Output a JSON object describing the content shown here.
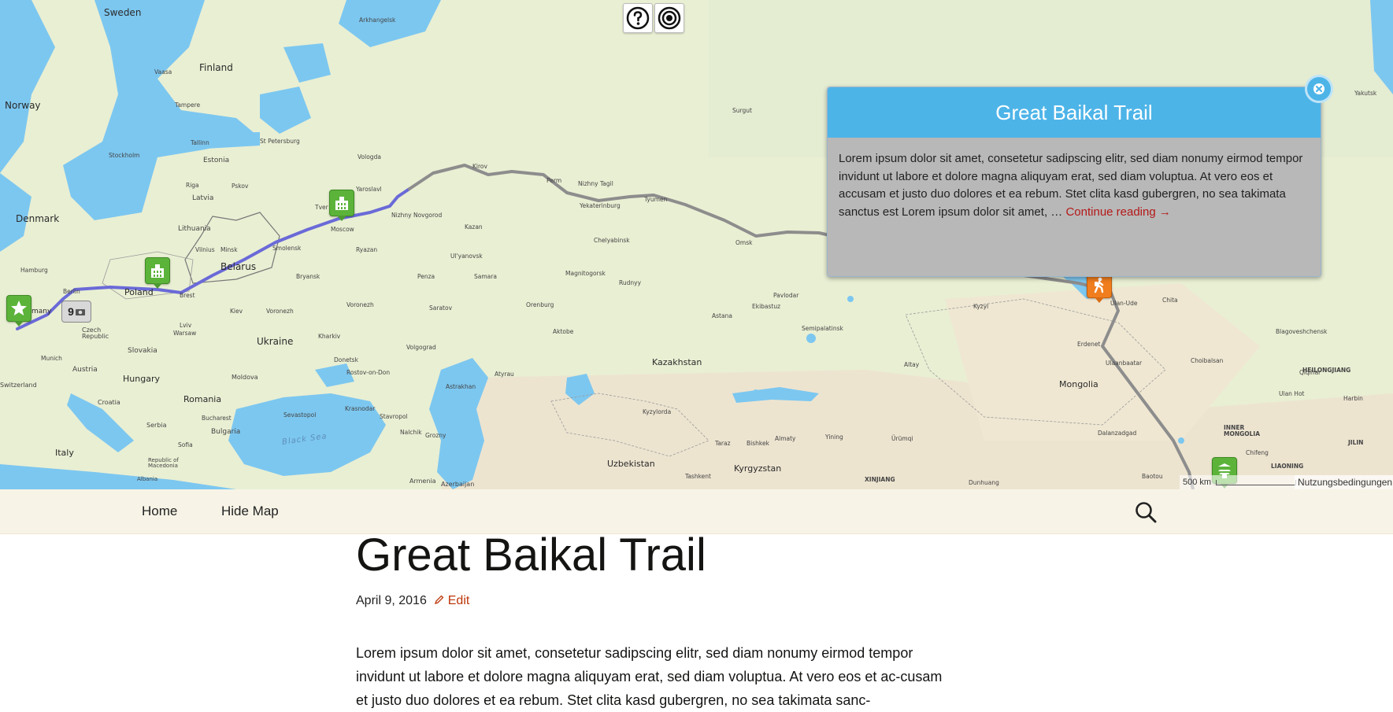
{
  "map": {
    "labels": {
      "sweden": "Sweden",
      "finland": "Finland",
      "norway": "Norway",
      "denmark": "Denmark",
      "estonia": "Estonia",
      "latvia": "Latvia",
      "lithuania": "Lithuania",
      "belarus": "Belarus",
      "poland": "Poland",
      "ukraine": "Ukraine",
      "czech": "Czech\nRepublic",
      "slovakia": "Slovakia",
      "austria": "Austria",
      "hungary": "Hungary",
      "romania": "Romania",
      "moldova": "Moldova",
      "serbia": "Serbia",
      "bulgaria": "Bulgaria",
      "croatia": "Croatia",
      "italy": "Italy",
      "kazakhstan": "Kazakhstan",
      "uzbekistan": "Uzbekistan",
      "kyrgyzstan": "Kyrgyzstan",
      "mongolia": "Mongolia",
      "armenia": "Armenia",
      "azerbaijan": "Azerbaijan",
      "albania": "Albania",
      "macedonia": "Republic of\nMacedonia",
      "switzerland": "Switzerland",
      "germany": "many",
      "black_sea": "Black Sea",
      "inner_mongolia": "INNER\nMONGOLIA",
      "liaoning": "LIAONING",
      "heilongjiang": "HEILONGJIANG",
      "jilin": "JILIN",
      "xinjiang": "XINJIANG",
      "moscow": "Moscow",
      "berlin": "Berlin",
      "minsk": "Minsk",
      "warsaw": "Warsaw",
      "kiev": "Kiev",
      "kharkiv": "Kharkiv",
      "donetsk": "Donetsk",
      "rostov": "Rostov-on-Don",
      "volgograd": "Volgograd",
      "saratov": "Saratov",
      "samara": "Samara",
      "kazan": "Kazan",
      "perm": "Perm",
      "yekaterinburg": "Yekaterinburg",
      "tyumen": "Tyumen",
      "omsk": "Omsk",
      "surgut": "Surgut",
      "nizhny_novgorod": "Nizhny Novgorod",
      "yaroslavl": "Yaroslavl",
      "vologda": "Vologda",
      "ryazan": "Ryazan",
      "penza": "Penza",
      "ulyanovsk": "Ul'yanovsk",
      "chelyabinsk": "Chelyabinsk",
      "magnitogorsk": "Magnitogorsk",
      "orenburg": "Orenburg",
      "aktobe": "Aktobe",
      "astana": "Astana",
      "pavlodar": "Pavlodar",
      "ekibastuz": "Ekibastuz",
      "semipalatinsk": "Semipalatinsk",
      "rudnyy": "Rudnyy",
      "kyzylorda": "Kyzylorda",
      "almaty": "Almaty",
      "bishkek": "Bishkek",
      "taraz": "Taraz",
      "tashkent": "Tashkent",
      "yining": "Yining",
      "urumqi": "Ürümqi",
      "dunhuang": "Dunhuang",
      "ulan_ude": "Ulan-Ude",
      "chita": "Chita",
      "erdenet": "Erdenet",
      "ulaanbaatar": "Ulaanbaatar",
      "dalanzadgad": "Dalanzadgad",
      "choibalsan": "Choibalsan",
      "qiqihar": "Qiqihar",
      "harbin": "Harbin",
      "ulan_hot": "Ulan Hot",
      "chifeng": "Chifeng",
      "baotou": "Baotou",
      "blagoveshchensk": "Blagoveshchensk",
      "yakutsk": "Yakutsk",
      "kyzyl": "Kyzyl",
      "altay": "Altay",
      "stockholm": "Stockholm",
      "tampere": "Tampere",
      "vaasa": "Vaasa",
      "st_petersburg": "St Petersburg",
      "pskov": "Pskov",
      "tver": "Tver",
      "arkhangelsk": "Arkhangelsk",
      "kirov": "Kirov",
      "nizhny_tagil": "Nizhny Tagil",
      "hamburg": "Hamburg",
      "munich": "Munich",
      "bucharest": "Bucharest",
      "sofia": "Sofia",
      "krasnodar": "Krasnodar",
      "stavropol": "Stavropol",
      "astrakhan": "Astrakhan",
      "atyrau": "Atyrau",
      "nalchik": "Nalchik",
      "grozny": "Grozny",
      "sevastopol": "Sevastopol",
      "voronezh": "Voronezh",
      "bryansk": "Bryansk",
      "smolensk": "Smolensk",
      "vilnius": "Vilnius",
      "riga": "Riga",
      "tallinn": "Tallinn",
      "lviv": "Lviv",
      "brest": "Brest"
    },
    "help_icon": "question-icon",
    "locate_icon": "target-icon",
    "camera_count": "9",
    "popup": {
      "title": "Great Baikal Trail",
      "text": "Lorem ipsum dolor sit amet, consetetur sadipscing elitr, sed diam nonumy eirmod tempor invidunt ut labore et dolore magna aliquyam erat, sed diam voluptua. At vero eos et accusam et justo duo dolores et ea rebum. Stet clita kasd gubergren, no sea takimata sanctus est Lorem ipsum dolor sit amet, …",
      "link": "Continue reading →"
    },
    "scale": "500 km",
    "terms": "Nutzungsbedingungen",
    "colors": {
      "route_walked": "#6a6ad8",
      "route_planned": "#8d8d8d",
      "water": "#7cc7f0",
      "land": "#e9efd3",
      "accent": "#4db4e8"
    }
  },
  "nav": {
    "home": "Home",
    "hide_map": "Hide Map",
    "search_icon": "search-icon"
  },
  "post": {
    "title": "Great Baikal Trail",
    "date": "April 9, 2016",
    "edit": "Edit",
    "excerpt": "Lorem ipsum dolor sit amet, consetetur sadipscing elitr, sed diam nonumy eirmod tempor invidunt ut labore et dolore magna aliquyam erat, sed diam voluptua. At vero eos et ac-cusam et justo duo dolores et ea rebum. Stet clita kasd gubergren, no sea takimata sanc-"
  }
}
